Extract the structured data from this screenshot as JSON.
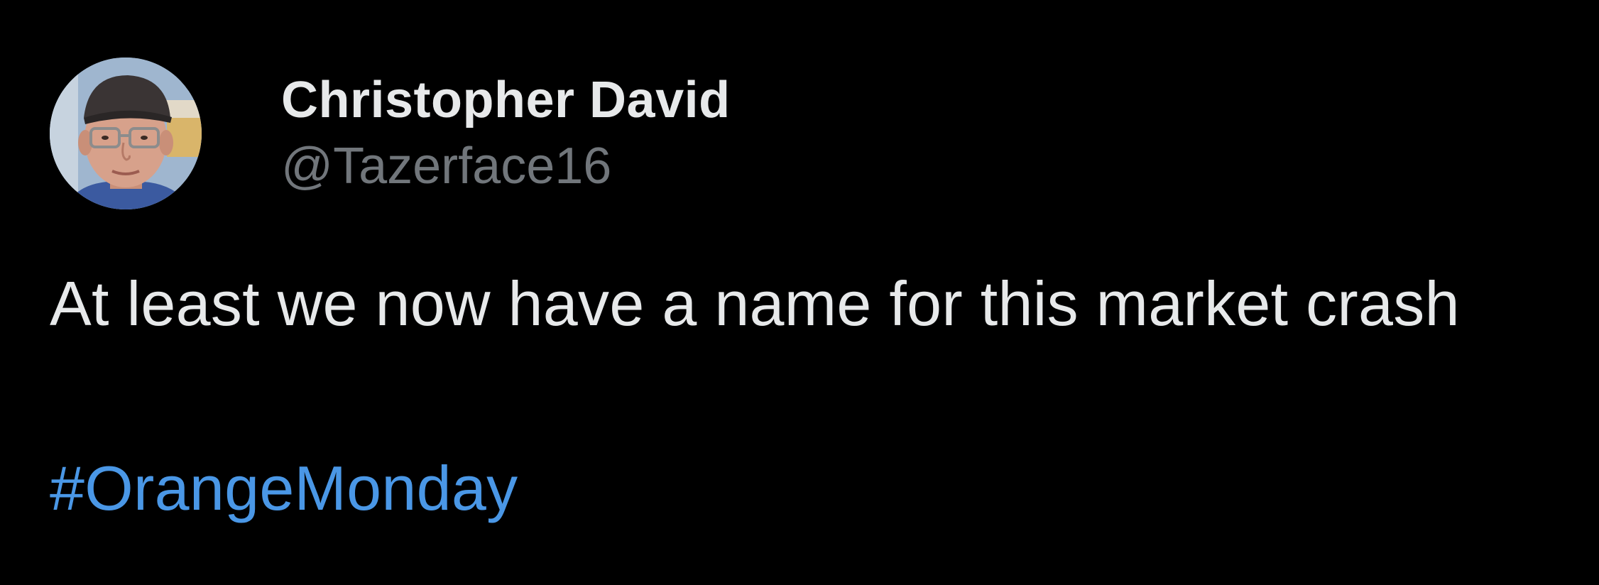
{
  "tweet": {
    "author": {
      "display_name": "Christopher David",
      "handle": "@Tazerface16"
    },
    "text": "At least we now have a name for this market crash",
    "hashtag": "#OrangeMonday"
  },
  "colors": {
    "background": "#000000",
    "text_primary": "#e7e9ea",
    "text_secondary": "#71767b",
    "link": "#4a97e6"
  }
}
